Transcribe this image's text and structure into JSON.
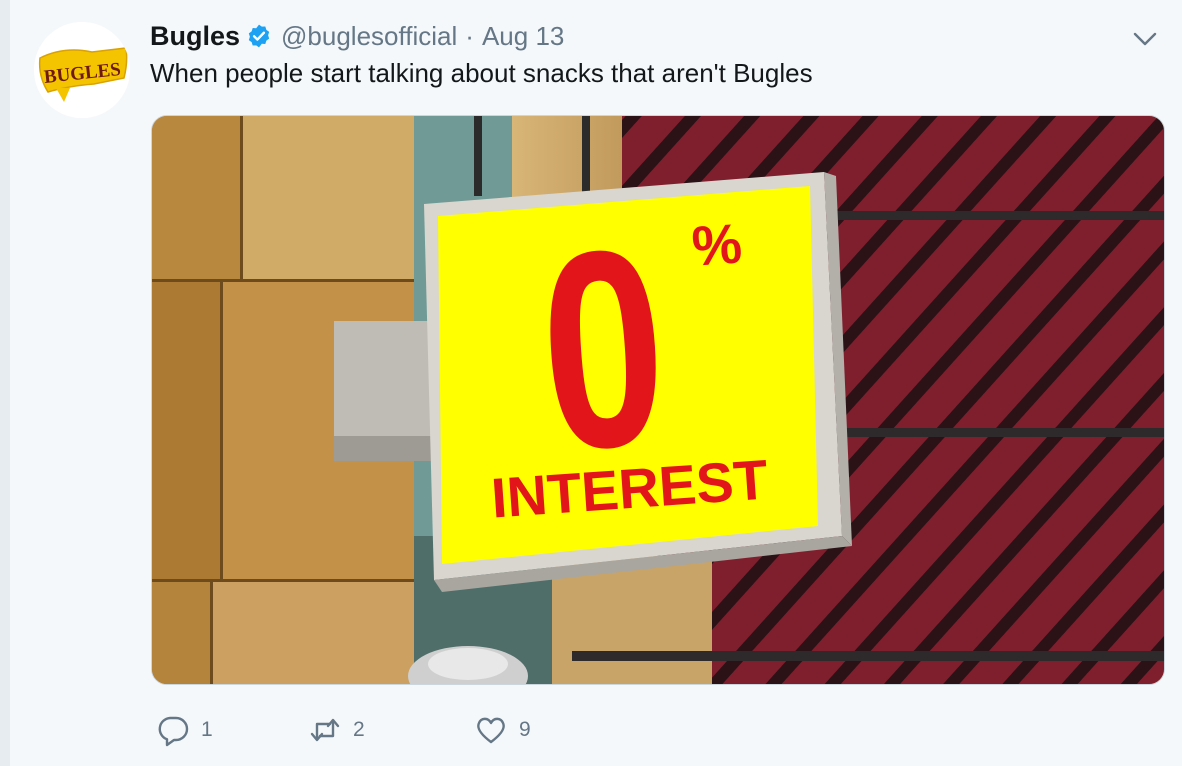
{
  "tweet": {
    "author_name": "Bugles",
    "handle": "@buglesofficial",
    "separator": "·",
    "date": "Aug 13",
    "text": "When people start talking about snacks that aren't Bugles",
    "avatar_logo_text": "BUGLES",
    "verified_icon": "verified-badge-icon",
    "more_icon": "chevron-down-icon"
  },
  "media": {
    "sign_big_digit": "0",
    "sign_percent": "%",
    "sign_word": "INTEREST",
    "colors": {
      "sign_yellow": "#ffff00",
      "sign_red": "#e2151b",
      "awning_red": "#8a2230",
      "stone": "#b88a46"
    }
  },
  "actions": {
    "reply": {
      "icon": "reply-icon",
      "count": "1"
    },
    "retweet": {
      "icon": "retweet-icon",
      "count": "2"
    },
    "like": {
      "icon": "heart-icon",
      "count": "9"
    }
  },
  "colors": {
    "background": "#f5f8fa",
    "text_primary": "#14171a",
    "text_secondary": "#657786",
    "verified_blue": "#1da1f2"
  }
}
